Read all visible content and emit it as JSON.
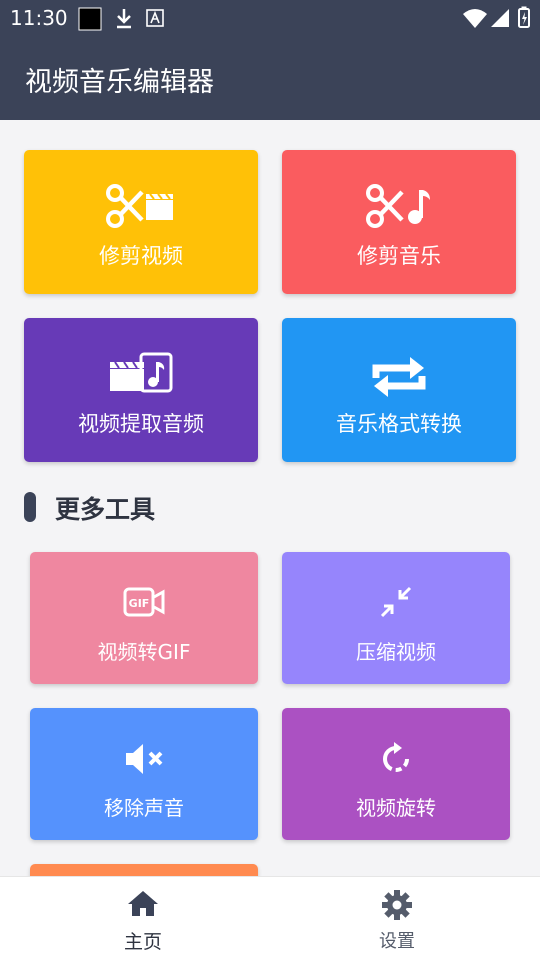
{
  "status_bar": {
    "time": "11:30"
  },
  "app_bar": {
    "title": "视频音乐编辑器"
  },
  "main_tools": [
    {
      "label": "修剪视频",
      "icon": "scissors-video-icon",
      "color": "#ffc107"
    },
    {
      "label": "修剪音乐",
      "icon": "scissors-music-icon",
      "color": "#fa5c5f"
    },
    {
      "label": "视频提取音频",
      "icon": "video-extract-audio-icon",
      "color": "#673ab7"
    },
    {
      "label": "音乐格式转换",
      "icon": "repeat-convert-icon",
      "color": "#2196f3"
    }
  ],
  "more_tools": {
    "title": "更多工具",
    "items": [
      {
        "label": "视频转GIF",
        "icon": "gif-icon",
        "color": "#ef87a0"
      },
      {
        "label": "压缩视频",
        "icon": "compress-icon",
        "color": "#9685fc"
      },
      {
        "label": "移除声音",
        "icon": "mute-icon",
        "color": "#5592fd"
      },
      {
        "label": "视频旋转",
        "icon": "rotate-icon",
        "color": "#ab51c2"
      }
    ]
  },
  "bottom_nav": [
    {
      "label": "主页",
      "icon": "home-icon",
      "active": true
    },
    {
      "label": "设置",
      "icon": "gear-icon",
      "active": false
    }
  ]
}
